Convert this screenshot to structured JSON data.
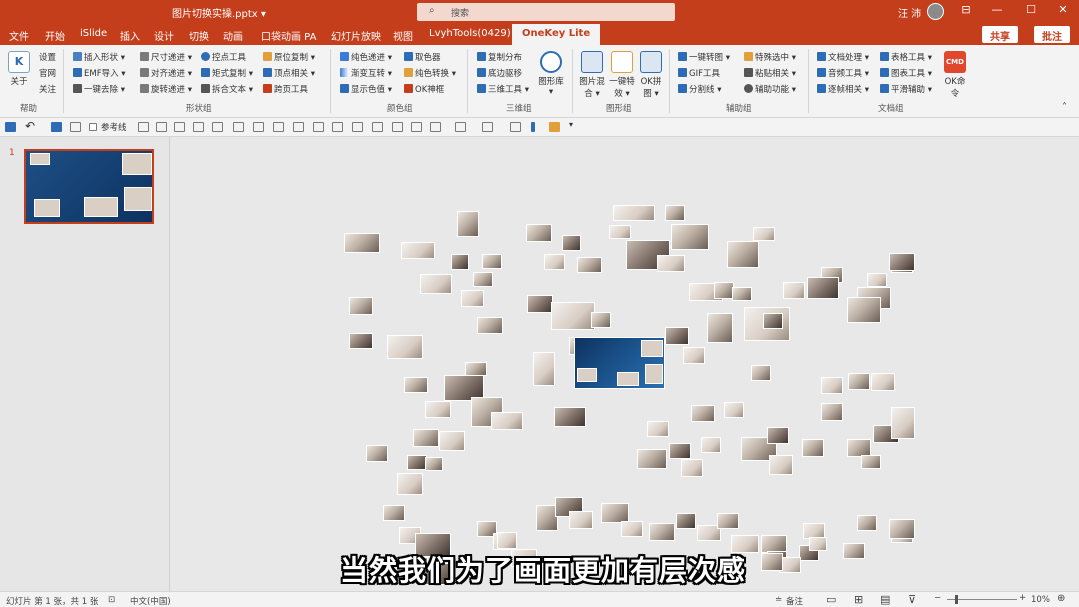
{
  "titlebar": {
    "doc_title": "图片切换实操.pptx ▾",
    "search_placeholder": "搜索",
    "user": "汪 沛",
    "win_ribbon": "⊟",
    "win_min": "—",
    "win_max": "☐",
    "win_close": "✕"
  },
  "tabs": [
    {
      "label": "文件"
    },
    {
      "label": "开始"
    },
    {
      "label": "iSlide"
    },
    {
      "label": "插入"
    },
    {
      "label": "设计"
    },
    {
      "label": "切换"
    },
    {
      "label": "动画"
    },
    {
      "label": "口袋动画 PA"
    },
    {
      "label": "幻灯片放映"
    },
    {
      "label": "视图"
    },
    {
      "label": "LvyhTools(0429)"
    },
    {
      "label": "OneKey Lite"
    }
  ],
  "share_label": "共享",
  "comment_label": "批注",
  "ribbon": {
    "help": {
      "about": "关于",
      "settings": "设置",
      "website": "官网",
      "follow": "关注",
      "label": "帮助"
    },
    "shape": {
      "items": [
        "插入形状 ▾",
        "EMF导入 ▾",
        "一键去除 ▾",
        "尺寸递进 ▾",
        "对齐递进 ▾",
        "旋转递进 ▾",
        "控点工具",
        "矩式复制 ▾",
        "拆合文本 ▾",
        "原位复制 ▾",
        "顶点相关 ▾",
        "跨页工具"
      ],
      "label": "形状组"
    },
    "color": {
      "items": [
        "纯色递进 ▾",
        "渐变互转 ▾",
        "显示色值 ▾",
        "取色器",
        "纯色转换 ▾",
        "OK神框"
      ],
      "label": "颜色组"
    },
    "three_d": {
      "items": [
        "复制分布",
        "底边驱移",
        "三维工具 ▾"
      ],
      "big": "图形库 ▾",
      "label": "三维组"
    },
    "image": {
      "big": [
        "图片混合 ▾",
        "一键特效 ▾",
        "OK拼图 ▾"
      ],
      "label": "图形组"
    },
    "assist": {
      "items": [
        "一键转图 ▾",
        "GIF工具",
        "分割线 ▾",
        "特殊选中 ▾",
        "粘贴相关 ▾",
        "辅助功能 ▾"
      ],
      "label": "辅助组"
    },
    "doc": {
      "items": [
        "文档处理 ▾",
        "音频工具 ▾",
        "逐帧相关 ▾",
        "表格工具 ▾",
        "图表工具 ▾",
        "平滑辅助 ▾"
      ],
      "big": "OK命令",
      "cmd": "CMD",
      "label": "文档组"
    }
  },
  "qat": {
    "guide_label": "参考线"
  },
  "slide_panel": {
    "number": "1"
  },
  "subtitle": "当然我们为了画面更加有层次感",
  "status": {
    "slide_info": "幻灯片 第 1 张，共 1 张",
    "language": "中文(中国)",
    "notes": "备注",
    "zoom": "10%"
  },
  "colors": {
    "brand": "#c43e1c",
    "ribbon_bg": "#f3f3f3",
    "canvas_bg": "#e8e8e8"
  }
}
